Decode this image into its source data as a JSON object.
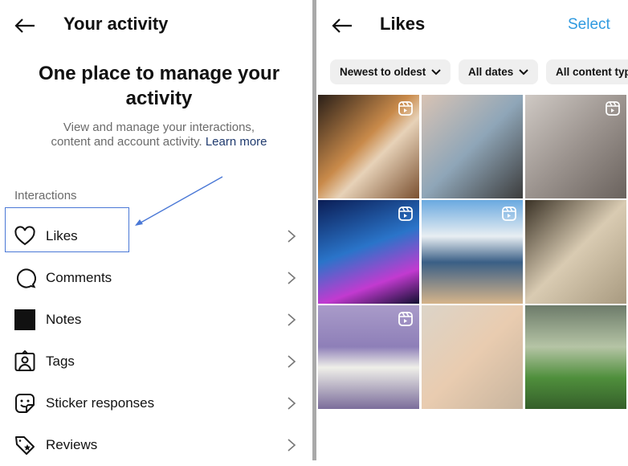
{
  "left": {
    "title": "Your activity",
    "hero": "One place to manage your activity",
    "description": "View and manage your interactions, content and account activity.",
    "learn_more": "Learn more",
    "section": "Interactions",
    "items": [
      {
        "label": "Likes",
        "icon": "heart-icon"
      },
      {
        "label": "Comments",
        "icon": "comment-icon"
      },
      {
        "label": "Notes",
        "icon": "notes-icon"
      },
      {
        "label": "Tags",
        "icon": "tag-person-icon"
      },
      {
        "label": "Sticker responses",
        "icon": "sticker-icon"
      },
      {
        "label": "Reviews",
        "icon": "review-tag-icon"
      }
    ],
    "highlight_color": "#4a78d6"
  },
  "right": {
    "title": "Likes",
    "select": "Select",
    "accent": "#2f9ae0",
    "filters": [
      "Newest to oldest",
      "All dates",
      "All content typ"
    ],
    "grid": [
      {
        "subject": "cat held in hand",
        "reel": true
      },
      {
        "subject": "painted nails",
        "reel": false
      },
      {
        "subject": "kitten lying down",
        "reel": true
      },
      {
        "subject": "aquarium blue room",
        "reel": true
      },
      {
        "subject": "Santorini seaside table",
        "reel": true
      },
      {
        "subject": "kitten on wall",
        "reel": false
      },
      {
        "subject": "white dog in lavender",
        "reel": true
      },
      {
        "subject": "three kittens",
        "reel": false
      },
      {
        "subject": "green slide landscape",
        "reel": false
      }
    ]
  }
}
